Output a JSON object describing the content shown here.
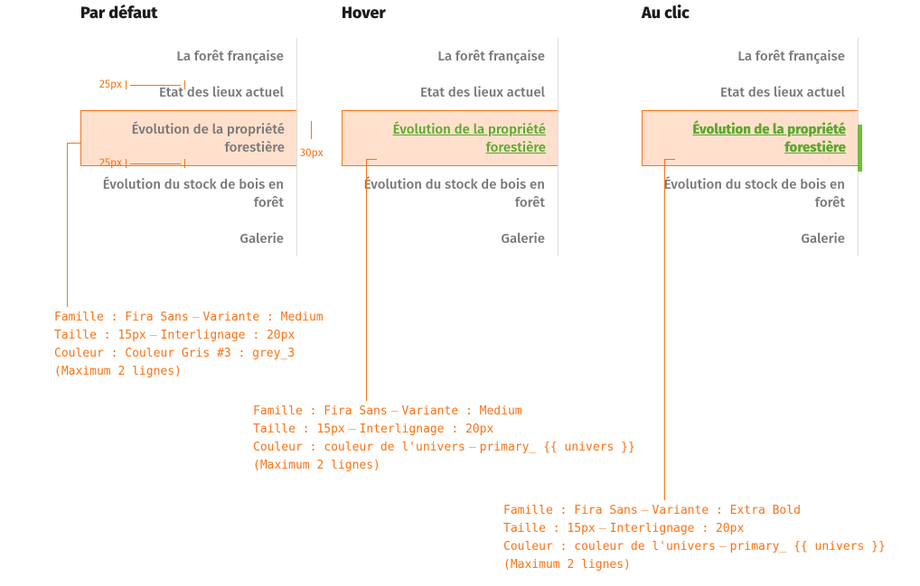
{
  "columns": {
    "default": {
      "title": "Par défaut"
    },
    "hover": {
      "title": "Hover"
    },
    "click": {
      "title": "Au clic"
    }
  },
  "menu": {
    "item1": "La forêt française",
    "item2": "Etat des lieux actuel",
    "item3": "Évolution de la propriété forestière",
    "item4": "Évolution du stock de bois en forêt",
    "item5": "Galerie"
  },
  "meas": {
    "top25": "25px",
    "bot25": "25px",
    "right30": "30px"
  },
  "specs": {
    "default": {
      "l1a": "Famille : Fira Sans",
      "l1b": "Variante : Medium",
      "l2a": "Taille : 15px",
      "l2b": "Interlignage : 20px",
      "l3": "Couleur : Couleur Gris #3 : grey_3",
      "l4": "(Maximum 2 lignes)"
    },
    "hover": {
      "l1a": "Famille : Fira Sans",
      "l1b": "Variante : Medium",
      "l2a": "Taille : 15px",
      "l2b": "Interlignage : 20px",
      "l3a": "Couleur : couleur de l'univers",
      "l3b": "primary_ {{ univers }}",
      "l4": "(Maximum 2 lignes)"
    },
    "click": {
      "l1a": "Famille : Fira Sans",
      "l1b": "Variante : Extra Bold",
      "l2a": "Taille : 15px",
      "l2b": "Interlignage : 20px",
      "l3a": "Couleur : couleur de l'univers",
      "l3b": "primary_ {{ univers }}",
      "l4": "(Maximum 2 lignes)"
    }
  }
}
